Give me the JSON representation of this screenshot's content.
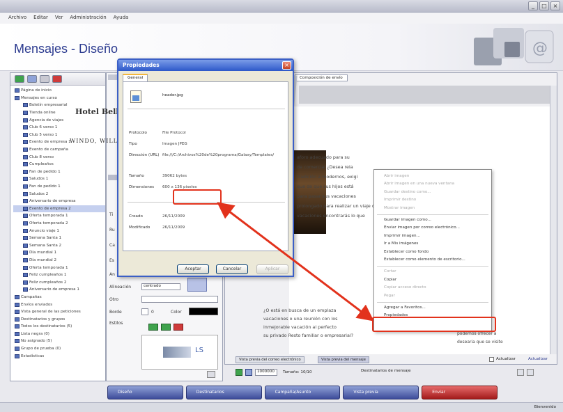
{
  "window": {
    "minimize": "_",
    "maximize": "□",
    "close": "×"
  },
  "menu": [
    "Archivo",
    "Editar",
    "Ver",
    "Administración",
    "Ayuda"
  ],
  "page_title": "Mensajes - Diseño",
  "tree": {
    "items": [
      "Página de inicio",
      "Mensajes en curso",
      "Boletín empresarial",
      "Tienda online",
      "Agencia de viajes",
      "Club 6 verso 1",
      "Club 5 verso 1",
      "Evento de empresa 1",
      "Evento de campaña",
      "Club 8 verso",
      "Cumpleaños",
      "Fan de pedido 1",
      "Saludos 1",
      "Fan de pedido 1",
      "Saludos 2",
      "Aniversario de empresa",
      "Evento de empresa 2",
      "Oferta temporada 1",
      "Oferta temporada 2",
      "Anuncio viaje 1",
      "Semana Santa 1",
      "Semana Santa 2",
      "Día mundial 1",
      "Día mundial 2",
      "Oferta temporada 1",
      "Feliz cumpleaños 1",
      "Feliz cumpleaños 2",
      "Aniversario de empresa 1",
      "Campañas",
      "Envíos enviados",
      "Vista general de las peticiones",
      "Destinatarios y grupos",
      "Todos los destinatarios (5)",
      "Lista negra (0)",
      "No asignado (5)",
      "Grupo de prueba (0)",
      "Estadísticas"
    ],
    "selected_index": 16
  },
  "form": {
    "labels": [
      "Ti",
      "Ru",
      "Ca",
      "Es",
      "An",
      "Alineación",
      "Otro",
      "Borde",
      "Estilos"
    ],
    "alignment_value": "centrado",
    "border_value": "0",
    "color_label": "Color",
    "preview_label": "LS"
  },
  "preview": {
    "tab_label": "Composición de envío",
    "hotel_title": "Hotel Bellevue",
    "welcome": "WINDO, WILLKOMMEN",
    "body_lines": [
      "aforo adecuado para su",
      "de comercial ¿Desea rela",
      "tradición a modernos, exigi",
      "que de que sus hijos está",
      "para pasar sus vacaciones",
      "prolongado para realizar un viaje cor",
      "vacaciones encontrarás lo que"
    ],
    "lower_lines": [
      "¿O está en busca de un emplaza",
      "vacaciones o una reunión con los",
      "inmejorable vacación al perfecto",
      "su privado Resto familiar o empresarial?"
    ],
    "side_text": [
      "podemos ofrecer a",
      "desearia que se visite"
    ],
    "bottom_tabs": [
      "Vista previa del correo electrónico",
      "Vista previa del mensaje"
    ],
    "bottom_checkbox": "Actualizar",
    "bottom_link": "Actualizar",
    "counter": "1000000",
    "size_label": "Tamaño: 10/10",
    "recipients_label": "Destinatarios de mensaje"
  },
  "dialog": {
    "title": "Propiedades",
    "tab": "General",
    "filename": "header.jpg",
    "rows": [
      {
        "label": "Protocolo",
        "value": "File Protocol"
      },
      {
        "label": "Tipo",
        "value": "Imagen JPEG"
      },
      {
        "label": "Dirección (URL)",
        "value": "file:///C:/Archivos%20de%20programa/Galaxy/Templates/"
      },
      {
        "label": "Tamaño",
        "value": "39062 bytes"
      },
      {
        "label": "Dimensiones",
        "value": "600 x 136 pixeles"
      }
    ],
    "created_label": "Creado",
    "created_value": "26/11/2009",
    "modified_label": "Modificado",
    "modified_value": "26/11/2009",
    "buttons": [
      "Aceptar",
      "Cancelar",
      "Aplicar"
    ]
  },
  "context_menu": {
    "items": [
      {
        "label": "Abrir imagen",
        "disabled": true
      },
      {
        "label": "Abrir imagen en una nueva ventana",
        "disabled": true
      },
      {
        "label": "Guardar destino como...",
        "disabled": true
      },
      {
        "label": "Imprimir destino",
        "disabled": true
      },
      {
        "label": "Mostrar imagen",
        "disabled": true
      },
      {
        "label": "Guardar imagen como...",
        "disabled": false
      },
      {
        "label": "Enviar imagen por correo electrónico...",
        "disabled": false
      },
      {
        "label": "Imprimir imagen...",
        "disabled": false
      },
      {
        "label": "Ir a Mis imágenes",
        "disabled": false
      },
      {
        "label": "Establecer como fondo",
        "disabled": false
      },
      {
        "label": "Establecer como elemento de escritorio...",
        "disabled": false
      },
      {
        "label": "Cortar",
        "disabled": true
      },
      {
        "label": "Copiar",
        "disabled": false
      },
      {
        "label": "Copiar acceso directo",
        "disabled": true
      },
      {
        "label": "Pegar",
        "disabled": true
      },
      {
        "label": "Agregar a Favoritos...",
        "disabled": false
      },
      {
        "label": "Propiedades",
        "disabled": false
      }
    ]
  },
  "bottom_nav": [
    "Diseño",
    "Destinatarios",
    "Campaña/Asunto",
    "Vista previa",
    "Enviar"
  ],
  "status": {
    "right": "Bienvenido"
  },
  "colors": {
    "accent": "#2b3a8f",
    "highlight": "#e2321c",
    "dialog_title": "#2d58c9"
  }
}
